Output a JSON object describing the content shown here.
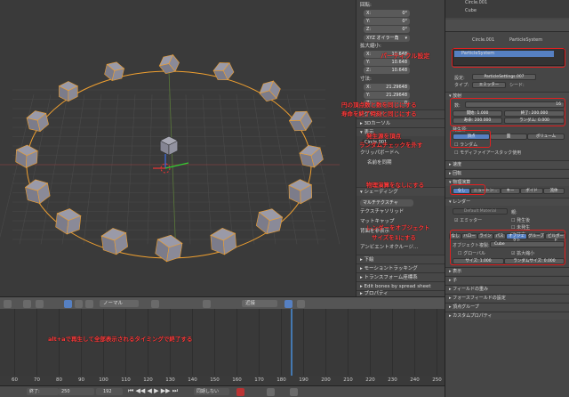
{
  "npanel": {
    "rotation_label": "回転:",
    "rot": [
      {
        "axis": "X:",
        "val": "0°"
      },
      {
        "axis": "Y:",
        "val": "0°"
      },
      {
        "axis": "Z:",
        "val": "0°"
      }
    ],
    "rot_mode": "XYZ オイラー角",
    "scale_label": "拡大縮小:",
    "scale": [
      {
        "axis": "X:",
        "val": "10.648"
      },
      {
        "axis": "Y:",
        "val": "10.648"
      },
      {
        "axis": "Z:",
        "val": "10.648"
      }
    ],
    "dim_label": "寸法:",
    "dims": [
      {
        "axis": "X:",
        "val": "21.29648"
      },
      {
        "axis": "Y:",
        "val": "21.29648"
      },
      {
        "axis": "Z:",
        "val": "0"
      }
    ],
    "sections": [
      "グリッド",
      "3Dカーソル",
      "表示"
    ],
    "item_name": "Circle.001",
    "clip_label": "クリッパボードへ",
    "name_btn": "名前を同期",
    "shading": "シェーディング",
    "multitex": "マルチテクスチャ",
    "tex_solid": "テクスチャソリッド",
    "matcap": "マットキャップ",
    "backface": "背面を非表示",
    "ambient": "アンビエントオクルージ...",
    "sections2": [
      "下絵",
      "モーショントラッキング",
      "トランスフォーム座標系",
      "Edit bones by spread sheet",
      "プロパティ"
    ]
  },
  "props": {
    "top_items": [
      "Circle.001",
      "Cube"
    ],
    "breadcrumb": [
      "Circle.001",
      "ParticleSystem"
    ],
    "ps_name": "ParticleSystem",
    "settings_label": "設定:",
    "settings_value": "ParticleSettings.007",
    "type_label": "タイプ:",
    "type_value": "エミッター",
    "seed_label": "シード:",
    "emission": "放射",
    "number_label": "数:",
    "number_value": "16",
    "start_label": "開始:",
    "start_value": "1.000",
    "end_label": "終了:",
    "end_value": "200.000",
    "life_label": "寿命:",
    "life_value": "200.000",
    "random_label": "ランダム:",
    "random_value": "0.000",
    "emit_from": "発生源:",
    "emit_opts": [
      "頂点",
      "面",
      "ボリューム"
    ],
    "random_chk": "ランダム",
    "modifier_stack": "モディファイアースタック使用",
    "velocity": "速度",
    "rotation": "回転",
    "physics": "物理演算",
    "physics_opts": [
      "なし",
      "ニュートン...",
      "キー",
      "ボイド",
      "流体"
    ],
    "render": "レンダー",
    "material_placeholder": "Default Material",
    "parent_label": "親:",
    "emitter_chk": "エミッター",
    "parent_chk": "発生後",
    "unborn_chk": "未発生",
    "died_chk": "死亡",
    "render_opts": [
      "なし",
      "ハロー",
      "ライン",
      "パス",
      "オブジェクト",
      "グループ",
      "ビルボード"
    ],
    "dupli_label": "オブジェクト複製:",
    "dupli_value": "Cube",
    "global_chk": "グローバル",
    "scale_chk": "拡大縮小",
    "size_label": "サイズ:",
    "size_value": "1.000",
    "rand_size_label": "ランダムサイズ:",
    "rand_size_value": "0.000",
    "bottom_sections": [
      "表示",
      "子",
      "フィールドの重み",
      "フォースフィールドの設定",
      "頂点グループ",
      "カスタムプロパティ"
    ]
  },
  "annotations": {
    "particle_setting": "パーティクル設定",
    "count_line1": "円の頂点数と数を同じにする",
    "count_line2": "寿命を終了時刻と同じにする",
    "emit_line1": "発生源を頂点",
    "emit_line2": "ランダムチェックを外す",
    "physics_note": "物理演算をなしにする",
    "render_line1": "レンダーをオブジェクト",
    "render_line2": "サイズを1にする",
    "timeline_note": "alt+aで再生して全部表示されるタイミングで終了する"
  },
  "vp_header": {
    "mode": "ノーマル",
    "pivot": "近接"
  },
  "ruler_ticks": [
    "60",
    "70",
    "80",
    "90",
    "100",
    "110",
    "120",
    "130",
    "140",
    "150",
    "160",
    "170",
    "180",
    "190",
    "200",
    "210",
    "220",
    "230",
    "240",
    "250"
  ],
  "footer": {
    "start_label": "終了:",
    "end_value": "250",
    "current_frame": "192",
    "sync": "同期しない"
  },
  "colors": {
    "accent": "#5680c2",
    "annotation": "#ff3b3b",
    "cursor_line": "#4da3ff",
    "selection": "#f0a030"
  }
}
